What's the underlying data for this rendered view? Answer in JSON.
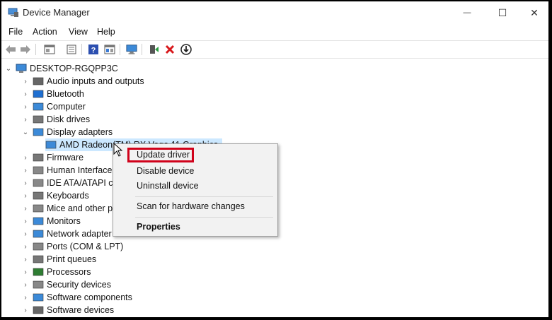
{
  "window": {
    "title": "Device Manager",
    "minimize_glyph": "—",
    "maximize_glyph": "☐",
    "close_glyph": "✕"
  },
  "menu": [
    "File",
    "Action",
    "View",
    "Help"
  ],
  "toolbar": {
    "icons": [
      "back-arrow-icon",
      "forward-arrow-icon",
      "properties-icon",
      "device-list-icon",
      "help-icon",
      "view-icon",
      "monitor-scan-icon",
      "update-driver-icon",
      "uninstall-icon",
      "download-icon"
    ]
  },
  "tree": {
    "root": "DESKTOP-RGQPP3C",
    "items": [
      {
        "label": "Audio inputs and outputs",
        "icon": "speaker-icon",
        "chevron": "›"
      },
      {
        "label": "Bluetooth",
        "icon": "bluetooth-icon",
        "chevron": "›"
      },
      {
        "label": "Computer",
        "icon": "computer-icon",
        "chevron": "›"
      },
      {
        "label": "Disk drives",
        "icon": "disk-drive-icon",
        "chevron": "›"
      },
      {
        "label": "Display adapters",
        "icon": "display-adapter-icon",
        "chevron": "⌄"
      },
      {
        "label": "AMD Radeon(TM) RX Vega 11 Graphics",
        "icon": "gpu-icon",
        "chevron": ""
      },
      {
        "label": "Firmware",
        "icon": "firmware-icon",
        "chevron": "›"
      },
      {
        "label": "Human Interface",
        "icon": "hid-icon",
        "chevron": "›"
      },
      {
        "label": "IDE ATA/ATAPI co",
        "icon": "ide-icon",
        "chevron": "›"
      },
      {
        "label": "Keyboards",
        "icon": "keyboard-icon",
        "chevron": "›"
      },
      {
        "label": "Mice and other p",
        "icon": "mouse-icon",
        "chevron": "›"
      },
      {
        "label": "Monitors",
        "icon": "monitor-icon",
        "chevron": "›"
      },
      {
        "label": "Network adapter",
        "icon": "network-icon",
        "chevron": "›"
      },
      {
        "label": "Ports (COM & LPT)",
        "icon": "port-icon",
        "chevron": "›"
      },
      {
        "label": "Print queues",
        "icon": "printer-icon",
        "chevron": "›"
      },
      {
        "label": "Processors",
        "icon": "processor-icon",
        "chevron": "›"
      },
      {
        "label": "Security devices",
        "icon": "security-icon",
        "chevron": "›"
      },
      {
        "label": "Software components",
        "icon": "software-component-icon",
        "chevron": "›"
      },
      {
        "label": "Software devices",
        "icon": "software-device-icon",
        "chevron": "›"
      }
    ]
  },
  "context_menu": {
    "update_driver": "Update driver",
    "disable_device": "Disable device",
    "uninstall_device": "Uninstall device",
    "scan": "Scan for hardware changes",
    "properties": "Properties"
  },
  "colors": {
    "selection": "#cce8ff",
    "highlight_box": "#d0021b",
    "menu_bg": "#f2f2f2"
  }
}
